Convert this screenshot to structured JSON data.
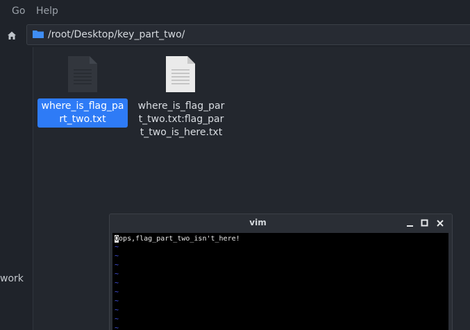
{
  "menubar": {
    "go": "Go",
    "help": "Help"
  },
  "pathbar": {
    "path": "/root/Desktop/key_part_two/"
  },
  "sidebar": {
    "partial_item": "work"
  },
  "files": [
    {
      "name": "where_is_flag_part_two.txt",
      "selected": true,
      "icon": "text-file-dark-icon"
    },
    {
      "name": "where_is_flag_part_two.txt:flag_part_two_is_here.txt",
      "selected": false,
      "icon": "text-file-light-icon"
    }
  ],
  "vim": {
    "title": "vim",
    "cursor_char": "O",
    "line_rest": "ops,flag_part_two_isn't_here!",
    "tilde": "~"
  },
  "colors": {
    "selection": "#2e7bf6",
    "background": "#23272e",
    "vim_tilde": "#4a5cff"
  }
}
